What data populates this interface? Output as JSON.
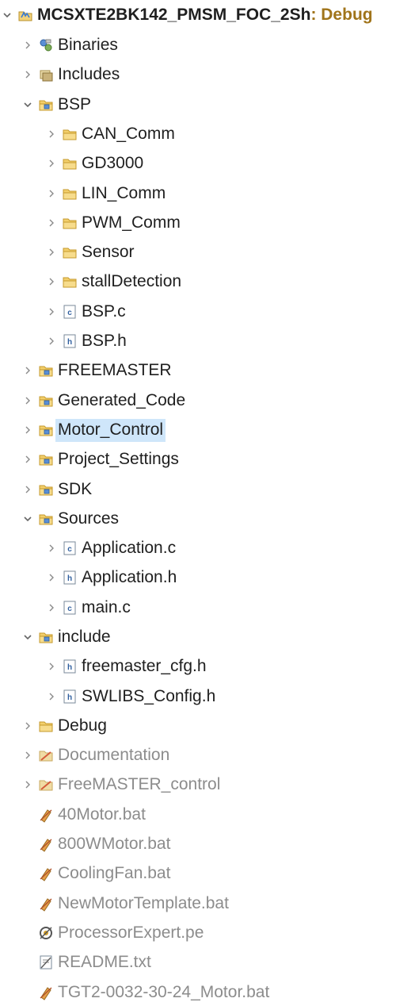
{
  "explorer": {
    "root": {
      "name": "MCSXTE2BK142_PMSM_FOC_2Sh",
      "decoration": ": Debug",
      "icon": "project-icon",
      "expanded": true
    },
    "items": [
      {
        "label": "Binaries",
        "icon": "binaries-icon",
        "twisty": "collapsed",
        "depth": 1
      },
      {
        "label": "Includes",
        "icon": "includes-icon",
        "twisty": "collapsed",
        "depth": 1
      },
      {
        "label": "BSP",
        "icon": "source-folder-icon",
        "twisty": "expanded",
        "depth": 1
      },
      {
        "label": "CAN_Comm",
        "icon": "folder-icon",
        "twisty": "collapsed",
        "depth": 2
      },
      {
        "label": "GD3000",
        "icon": "folder-icon",
        "twisty": "collapsed",
        "depth": 2
      },
      {
        "label": "LIN_Comm",
        "icon": "folder-icon",
        "twisty": "collapsed",
        "depth": 2
      },
      {
        "label": "PWM_Comm",
        "icon": "folder-icon",
        "twisty": "collapsed",
        "depth": 2
      },
      {
        "label": "Sensor",
        "icon": "folder-icon",
        "twisty": "collapsed",
        "depth": 2
      },
      {
        "label": "stallDetection",
        "icon": "folder-icon",
        "twisty": "collapsed",
        "depth": 2
      },
      {
        "label": "BSP.c",
        "icon": "c-file-icon",
        "twisty": "collapsed",
        "depth": 2
      },
      {
        "label": "BSP.h",
        "icon": "h-file-icon",
        "twisty": "collapsed",
        "depth": 2
      },
      {
        "label": "FREEMASTER",
        "icon": "source-folder-icon",
        "twisty": "collapsed",
        "depth": 1
      },
      {
        "label": "Generated_Code",
        "icon": "source-folder-icon",
        "twisty": "collapsed",
        "depth": 1
      },
      {
        "label": "Motor_Control",
        "icon": "source-folder-icon",
        "twisty": "collapsed",
        "depth": 1,
        "selected": true
      },
      {
        "label": "Project_Settings",
        "icon": "source-folder-icon",
        "twisty": "collapsed",
        "depth": 1
      },
      {
        "label": "SDK",
        "icon": "source-folder-icon",
        "twisty": "collapsed",
        "depth": 1
      },
      {
        "label": "Sources",
        "icon": "source-folder-icon",
        "twisty": "expanded",
        "depth": 1
      },
      {
        "label": "Application.c",
        "icon": "c-file-icon",
        "twisty": "collapsed",
        "depth": 2
      },
      {
        "label": "Application.h",
        "icon": "h-file-icon",
        "twisty": "collapsed",
        "depth": 2
      },
      {
        "label": "main.c",
        "icon": "c-file-icon",
        "twisty": "collapsed",
        "depth": 2
      },
      {
        "label": "include",
        "icon": "source-folder-icon",
        "twisty": "expanded",
        "depth": 1
      },
      {
        "label": "freemaster_cfg.h",
        "icon": "h-file-icon",
        "twisty": "collapsed",
        "depth": 2
      },
      {
        "label": "SWLIBS_Config.h",
        "icon": "h-file-icon",
        "twisty": "collapsed",
        "depth": 2
      },
      {
        "label": "Debug",
        "icon": "folder-icon",
        "twisty": "collapsed",
        "depth": 1
      },
      {
        "label": "Documentation",
        "icon": "excluded-folder-icon",
        "twisty": "collapsed",
        "depth": 1,
        "dim": true
      },
      {
        "label": "FreeMASTER_control",
        "icon": "excluded-folder-icon",
        "twisty": "collapsed",
        "depth": 1,
        "dim": true
      },
      {
        "label": "40Motor.bat",
        "icon": "excluded-file-icon",
        "twisty": "none",
        "depth": 1,
        "dim": true
      },
      {
        "label": "800WMotor.bat",
        "icon": "excluded-file-icon",
        "twisty": "none",
        "depth": 1,
        "dim": true
      },
      {
        "label": "CoolingFan.bat",
        "icon": "excluded-file-icon",
        "twisty": "none",
        "depth": 1,
        "dim": true
      },
      {
        "label": "NewMotorTemplate.bat",
        "icon": "excluded-file-icon",
        "twisty": "none",
        "depth": 1,
        "dim": true
      },
      {
        "label": "ProcessorExpert.pe",
        "icon": "processor-expert-icon",
        "twisty": "none",
        "depth": 1,
        "dim": true
      },
      {
        "label": "README.txt",
        "icon": "text-file-icon",
        "twisty": "none",
        "depth": 1,
        "dim": true
      },
      {
        "label": "TGT2-0032-30-24_Motor.bat",
        "icon": "excluded-file-icon",
        "twisty": "none",
        "depth": 1,
        "dim": true
      }
    ]
  }
}
